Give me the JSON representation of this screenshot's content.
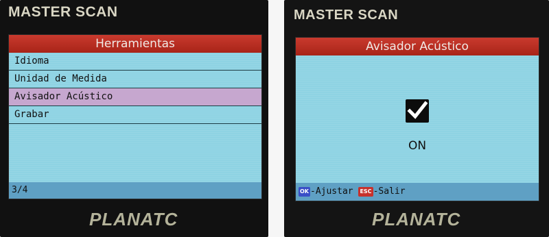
{
  "left_device": {
    "brand_top": "MASTER SCAN",
    "brand_bottom": "PLANATC",
    "title": "Herramientas",
    "menu_items": [
      {
        "label": "Idioma"
      },
      {
        "label": "Unidad de Medida"
      },
      {
        "label": "Avisador Acústico"
      },
      {
        "label": "Grabar"
      }
    ],
    "selected_index": 2,
    "status": "3/4"
  },
  "right_device": {
    "brand_top": "MASTER SCAN",
    "brand_bottom": "PLANATC",
    "title": "Avisador Acústico",
    "checkbox_checked": true,
    "state_label": "ON",
    "footer": {
      "ok_key": "OK",
      "ok_label": "-Ajustar",
      "esc_key": "ESC",
      "esc_label": "-Salir"
    }
  },
  "colors": {
    "screen_bg": "#8ed3e3",
    "title_bar": "#b8302a",
    "selected_row": "#c6a7cf",
    "status_bar": "#5fa0c4"
  }
}
